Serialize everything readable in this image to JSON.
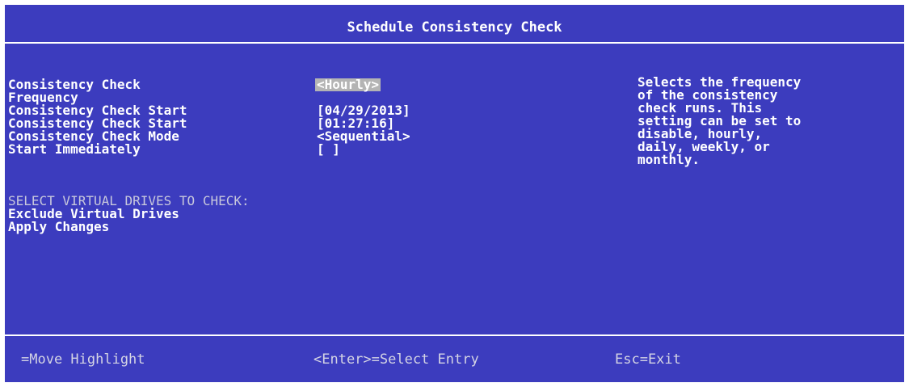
{
  "window": {
    "title": "Schedule Consistency Check"
  },
  "fields": [
    {
      "label": "Consistency Check",
      "value": "<Hourly>"
    },
    {
      "label": "Frequency",
      "value": ""
    },
    {
      "label": "Consistency Check Start",
      "value": "[04/29/2013]"
    },
    {
      "label": "Consistency Check Start",
      "value": "[01:27:16]"
    },
    {
      "label": "Consistency Check Mode",
      "value": "<Sequential>"
    },
    {
      "label": "Start Immediately",
      "value": "[ ]"
    }
  ],
  "section": {
    "heading": "SELECT VIRTUAL DRIVES TO CHECK:"
  },
  "actions": [
    {
      "label": "Exclude Virtual Drives"
    },
    {
      "label": "Apply Changes"
    }
  ],
  "help": {
    "lines": [
      "Selects the frequency",
      "of the consistency",
      "check runs. This",
      "setting can be set to",
      "disable, hourly,",
      "daily, weekly, or",
      "monthly."
    ]
  },
  "footer": {
    "move": "=Move Highlight",
    "enter": "<Enter>=Select Entry",
    "esc": "Esc=Exit"
  },
  "colors": {
    "background": "#3c3cbe",
    "highlight": "#b4b4b4",
    "text": "#ffffff"
  }
}
